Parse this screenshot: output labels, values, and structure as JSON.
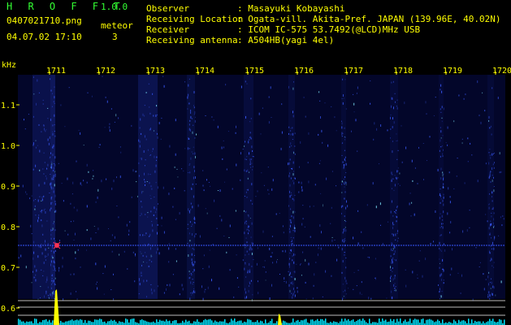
{
  "header": {
    "app_name": "H R O F F T",
    "app_version": "1.0.0",
    "file_name": "0407021710.png",
    "timestamp": "04.07.02 17:10",
    "meteor_label": "meteor",
    "meteor_count": "3"
  },
  "info": [
    {
      "key": "Observer",
      "value": ": Masayuki Kobayashi"
    },
    {
      "key": "Receiving Location",
      "value": ": Ogata-vill. Akita-Pref. JAPAN (139.96E, 40.02N)"
    },
    {
      "key": "Receiver",
      "value": ": ICOM IC-575 53.7492(@LCD)MHz USB"
    },
    {
      "key": "Receiving antenna",
      "value": ": A504HB(yagi 4el)"
    }
  ],
  "axes": {
    "y_unit": "kHz",
    "y_ticks": [
      "1.1",
      "1.0",
      "0.9",
      "0.8",
      "0.7",
      "0.6"
    ],
    "x_ticks": [
      "1711",
      "1712",
      "1713",
      "1714",
      "1715",
      "1716",
      "1717",
      "1718",
      "1719",
      "1720"
    ]
  },
  "colors": {
    "background": "#000000",
    "text": "#ffff00",
    "title": "#33ff33",
    "spectrum": "#2b46d8",
    "trace": "#00e5ff",
    "marker": "#ff3355"
  }
}
